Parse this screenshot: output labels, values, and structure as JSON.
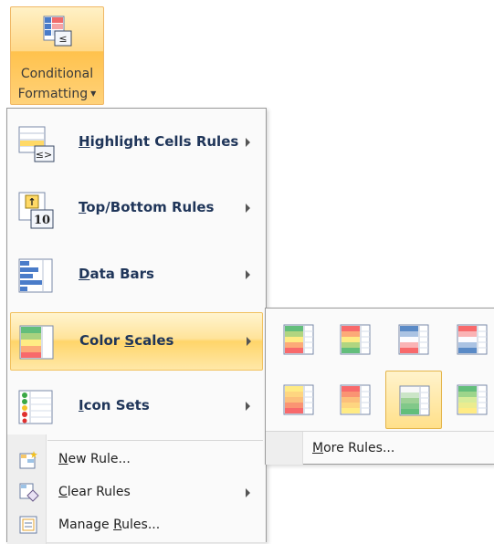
{
  "ribbon": {
    "button_line1": "Conditional",
    "button_line2": "Formatting",
    "icon": "conditional-formatting-icon"
  },
  "menu": {
    "items": [
      {
        "pre": "",
        "key": "H",
        "post": "ighlight Cells Rules",
        "icon": "highlight-cells-icon",
        "submenu": true
      },
      {
        "pre": "",
        "key": "T",
        "post": "op/Bottom Rules",
        "icon": "top-bottom-icon",
        "submenu": true
      },
      {
        "pre": "",
        "key": "D",
        "post": "ata Bars",
        "icon": "data-bars-icon",
        "submenu": true
      },
      {
        "pre": "Color ",
        "key": "S",
        "post": "cales",
        "icon": "color-scales-icon",
        "submenu": true,
        "highlighted": true
      },
      {
        "pre": "",
        "key": "I",
        "post": "con Sets",
        "icon": "icon-sets-icon",
        "submenu": true
      }
    ],
    "small_items": [
      {
        "pre": "",
        "key": "N",
        "post": "ew Rule...",
        "icon": "new-rule-icon",
        "submenu": false
      },
      {
        "pre": "",
        "key": "C",
        "post": "lear Rules",
        "icon": "clear-rules-icon",
        "submenu": true
      },
      {
        "pre": "Manage ",
        "key": "R",
        "post": "ules...",
        "icon": "manage-rules-icon",
        "submenu": false
      }
    ]
  },
  "submenu": {
    "more_rules": {
      "pre": "",
      "key": "M",
      "post": "ore Rules..."
    },
    "scales": [
      [
        "#63be7b",
        "#ffeb84",
        "#f8696b"
      ],
      [
        "#f8696b",
        "#ffeb84",
        "#63be7b"
      ],
      [
        "#5a8ac6",
        "#fcfcff",
        "#f8696b"
      ],
      [
        "#f8696b",
        "#fcfcff",
        "#5a8ac6"
      ],
      [
        "#ffeb84",
        "#fcbf7b",
        "#f8696b"
      ],
      [
        "#f8696b",
        "#fcbf7b",
        "#ffeb84"
      ],
      [
        "#f8f8f8",
        "#9ed196",
        "#63be7b"
      ],
      [
        "#63be7b",
        "#d6ec9a",
        "#ffeb84"
      ]
    ],
    "selected_index": 6
  }
}
